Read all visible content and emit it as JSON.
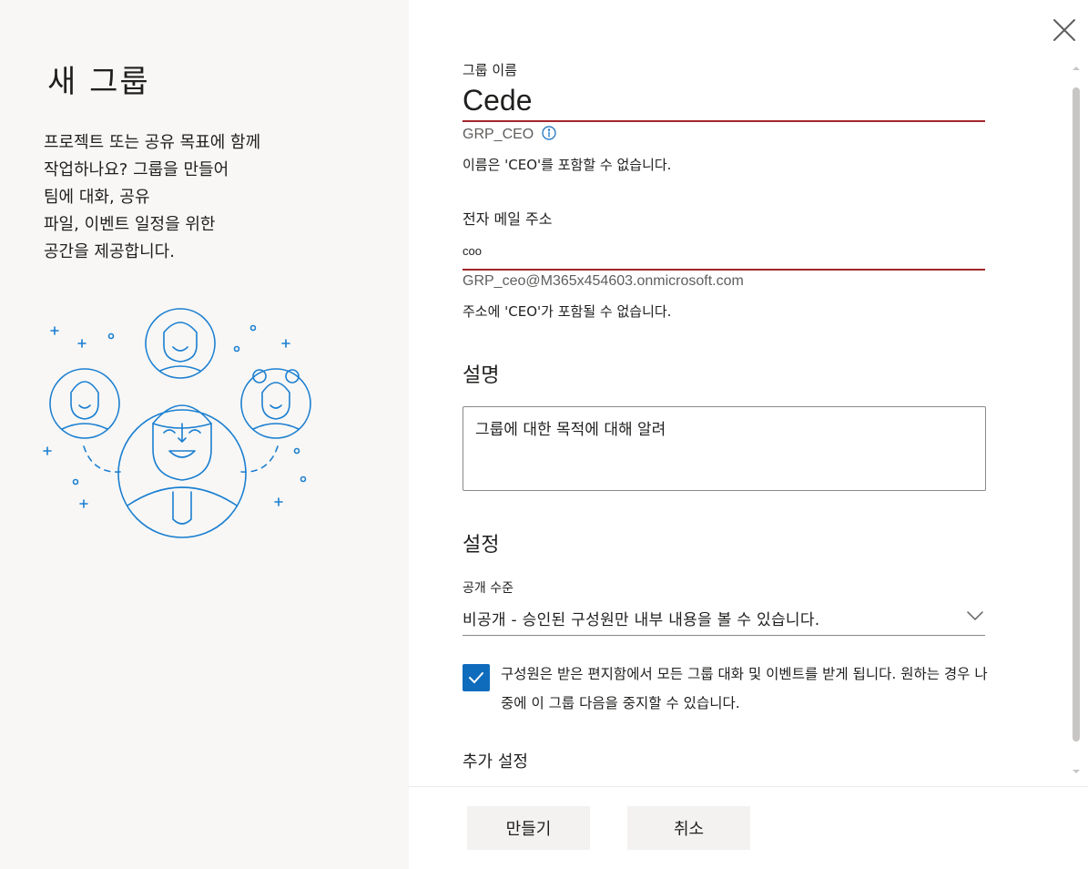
{
  "left_panel": {
    "title": "새 그룹",
    "description": "프로젝트 또는 공유 목표에 함께\n작업하나요? 그룹을 만들어\n팀에 대화, 공유\n파일, 이벤트 일정을 위한\n공간을 제공합니다."
  },
  "form": {
    "group_name": {
      "label": "그룹 이름",
      "value": "Cede",
      "alias_hint": "GRP_CEO",
      "error": "이름은 'CEO'를 포함할 수 없습니다."
    },
    "email": {
      "label": "전자 메일 주소",
      "value": "coo",
      "address_hint": "GRP_ceo@M365x454603.onmicrosoft.com",
      "error": "주소에 'CEO'가 포함될 수 없습니다."
    },
    "description": {
      "title": "설명",
      "value": "그룹에 대한 목적에 대해 알려"
    },
    "settings": {
      "title": "설정",
      "privacy_label": "공개 수준",
      "privacy_value": "비공개 - 승인된 구성원만 내부 내용을 볼 수 있습니다.",
      "subscribe_checked": true,
      "subscribe_label": "구성원은 받은 편지함에서 모든 그룹 대화 및 이벤트를 받게 됩니다. 원하는 경우 나중에 이 그룹 다음을 중지할 수 있습니다.",
      "more_settings": "추가 설정"
    }
  },
  "footer": {
    "create_label": "만들기",
    "cancel_label": "취소"
  },
  "colors": {
    "error_underline": "#a4262c",
    "accent": "#0f6cbd",
    "illustration": "#1b7fd1"
  },
  "icons": [
    "close-icon",
    "info-icon",
    "chevron-down-icon",
    "checkmark-icon"
  ]
}
